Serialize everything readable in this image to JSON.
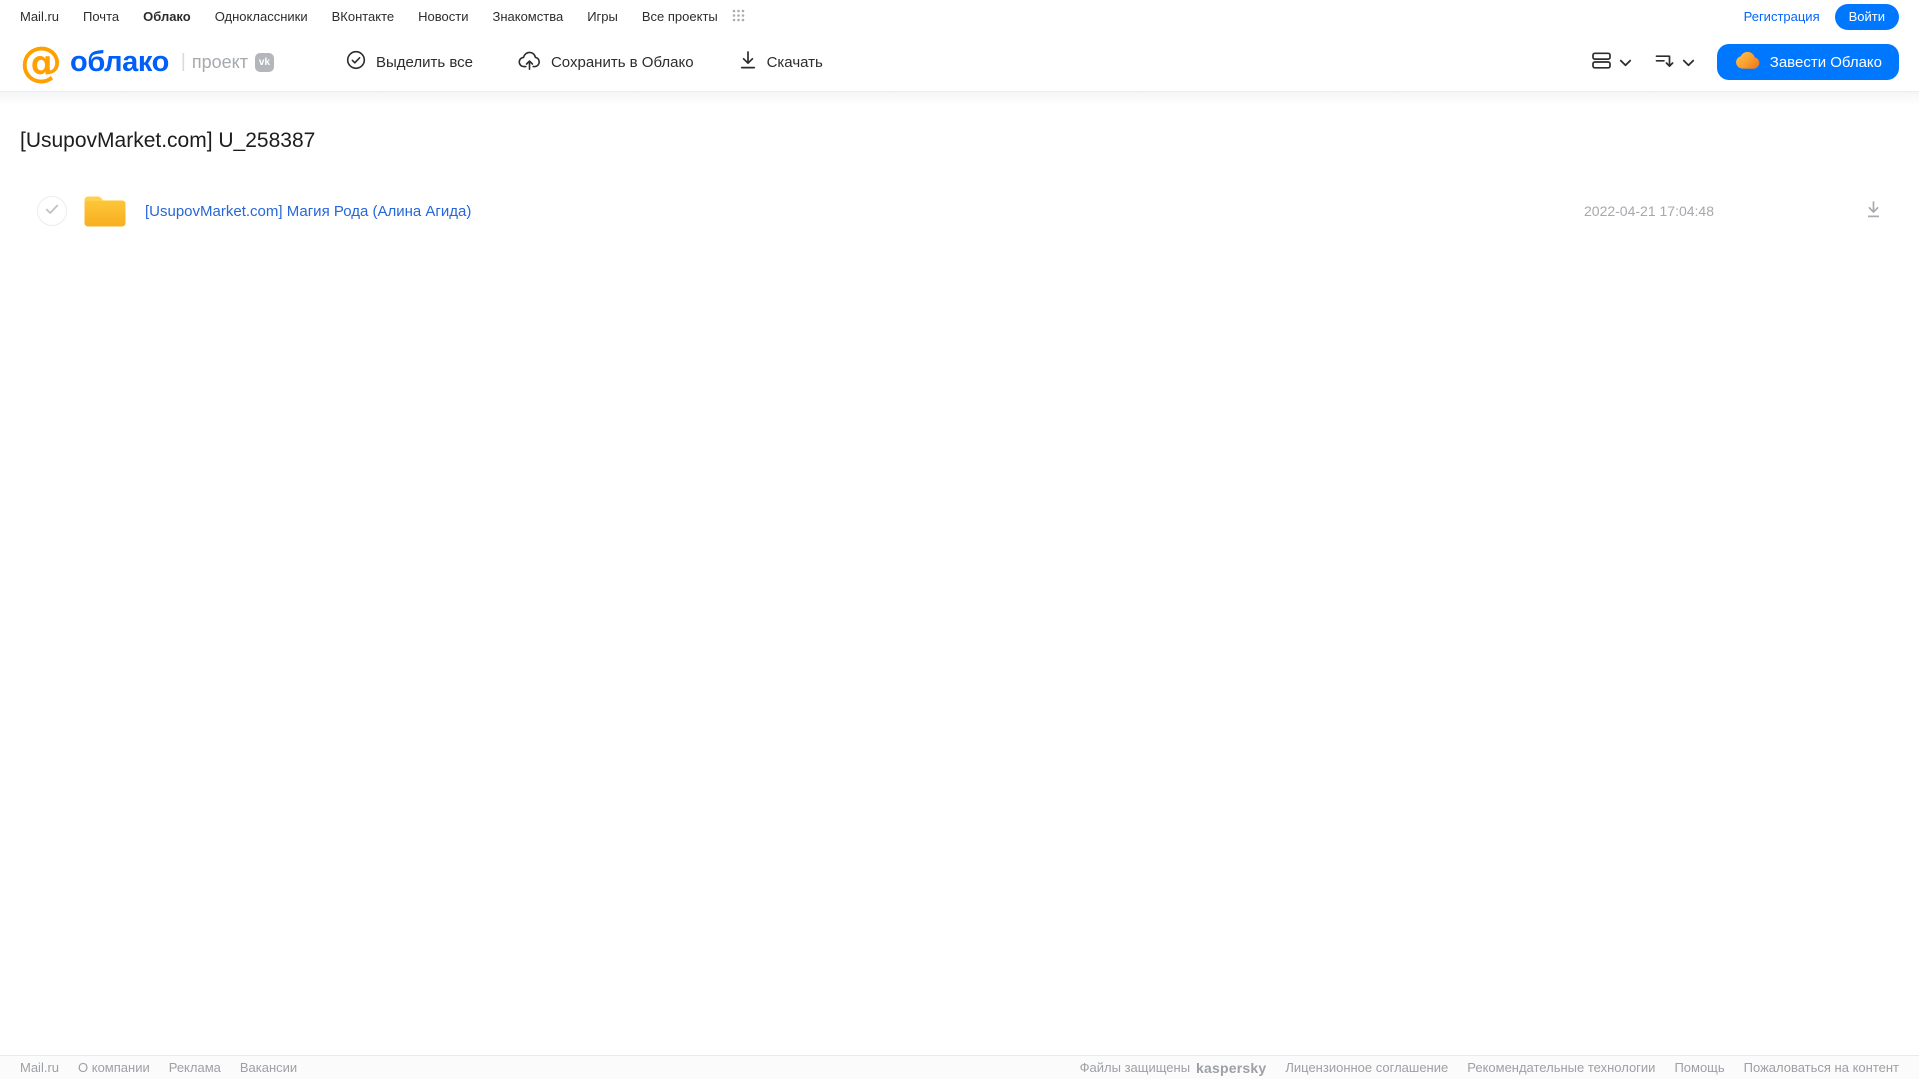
{
  "topnav": {
    "links": [
      {
        "label": "Mail.ru"
      },
      {
        "label": "Почта"
      },
      {
        "label": "Облако",
        "active": true
      },
      {
        "label": "Одноклассники"
      },
      {
        "label": "ВКонтакте"
      },
      {
        "label": "Новости"
      },
      {
        "label": "Знакомства"
      },
      {
        "label": "Игры"
      },
      {
        "label": "Все проекты"
      }
    ],
    "registration_label": "Регистрация",
    "login_label": "Войти"
  },
  "header": {
    "logo": {
      "at_symbol": "@",
      "product": "облако",
      "separator": "|",
      "project_label": "проект",
      "vk_badge": "vk"
    },
    "toolbar": {
      "select_all_label": "Выделить все",
      "save_to_cloud_label": "Сохранить в Облако",
      "download_label": "Скачать"
    },
    "get_cloud_label": "Завести Облако"
  },
  "main": {
    "title": "[UsupovMarket.com] U_258387",
    "files": [
      {
        "type": "folder",
        "name": "[UsupovMarket.com] Магия Рода (Алина Агида)",
        "modified": "2022-04-21 17:04:48",
        "selected": false
      }
    ]
  },
  "footer": {
    "left_links": [
      "Mail.ru",
      "О компании",
      "Реклама",
      "Вакансии"
    ],
    "protected_label": "Файлы защищены",
    "kaspersky_label": "kaspersky",
    "right_links": [
      "Лицензионное соглашение",
      "Рекомендательные технологии",
      "Помощь",
      "Пожаловаться на контент"
    ]
  },
  "colors": {
    "accent_blue": "#0077ff",
    "link_blue": "#005ff9",
    "logo_orange": "#ffa000",
    "folder_yellow": "#f8ae1f",
    "kaspersky_teal": "#00a88e",
    "muted_gray": "#a5a8ad"
  }
}
